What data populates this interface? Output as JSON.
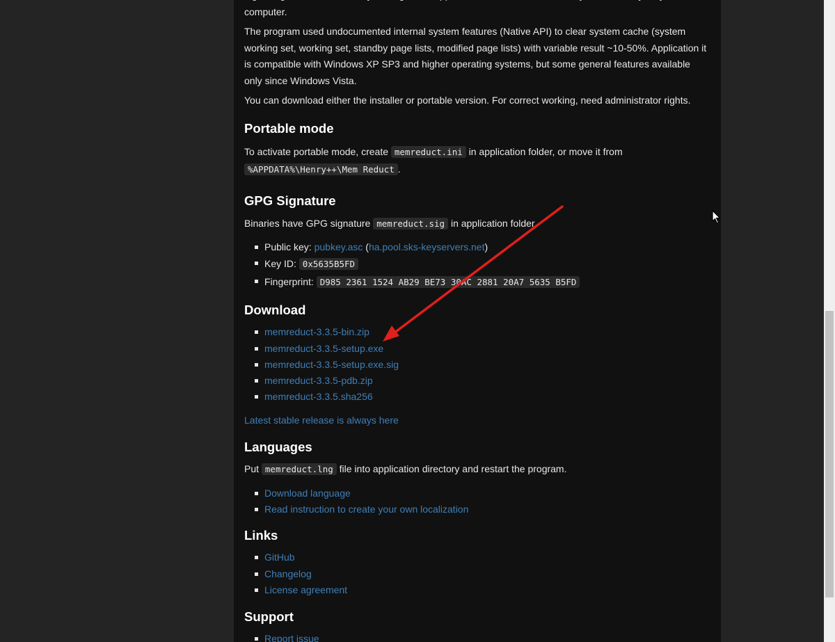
{
  "intro": {
    "p1": "Lightweight real-time memory management application to monitor and clean system memory on your computer.",
    "p2": "The program used undocumented internal system features (Native API) to clear system cache (system working set, working set, standby page lists, modified page lists) with variable result ~10-50%. Application it is compatible with Windows XP SP3 and higher operating systems, but some general features available only since Windows Vista.",
    "p3": "You can download either the installer or portable version. For correct working, need administrator rights."
  },
  "portable": {
    "title": "Portable mode",
    "text_before": "To activate portable mode, create",
    "code1": "memreduct.ini",
    "text_middle": "in application folder, or move it from",
    "code2": "%APPDATA%\\Henry++\\Mem Reduct",
    "text_after": "."
  },
  "gpg": {
    "title": "GPG Signature",
    "text_before": "Binaries have GPG signature",
    "code": "memreduct.sig",
    "text_after": "in application folder.",
    "public_key_label": "Public key:",
    "public_key_link": "pubkey.asc",
    "keyserver_link": "ha.pool.sks-keyservers.net",
    "key_id_label": "Key ID:",
    "key_id": "0x5635B5FD",
    "fingerprint_label": "Fingerprint:",
    "fingerprint": "D985 2361 1524 AB29 BE73 30AC 2881 20A7 5635 B5FD"
  },
  "download": {
    "title": "Download",
    "files": [
      "memreduct-3.3.5-bin.zip",
      "memreduct-3.3.5-setup.exe",
      "memreduct-3.3.5-setup.exe.sig",
      "memreduct-3.3.5-pdb.zip",
      "memreduct-3.3.5.sha256"
    ],
    "latest_link": "Latest stable release is always here"
  },
  "languages": {
    "title": "Languages",
    "text_before": "Put",
    "code": "memreduct.lng",
    "text_after": "file into application directory and restart the program.",
    "links": [
      "Download language",
      "Read instruction to create your own localization"
    ]
  },
  "links_section": {
    "title": "Links",
    "links": [
      "GitHub",
      "Changelog",
      "License agreement"
    ]
  },
  "support": {
    "title": "Support",
    "links": [
      "Report issue"
    ]
  },
  "colors": {
    "background": "#111111",
    "side_panels": "#242424",
    "text": "#e8e8e8",
    "link": "#3f7fb8",
    "annotation_arrow": "#e0201b"
  },
  "icons": [
    "mouse-cursor-icon",
    "red-annotation-arrow"
  ]
}
